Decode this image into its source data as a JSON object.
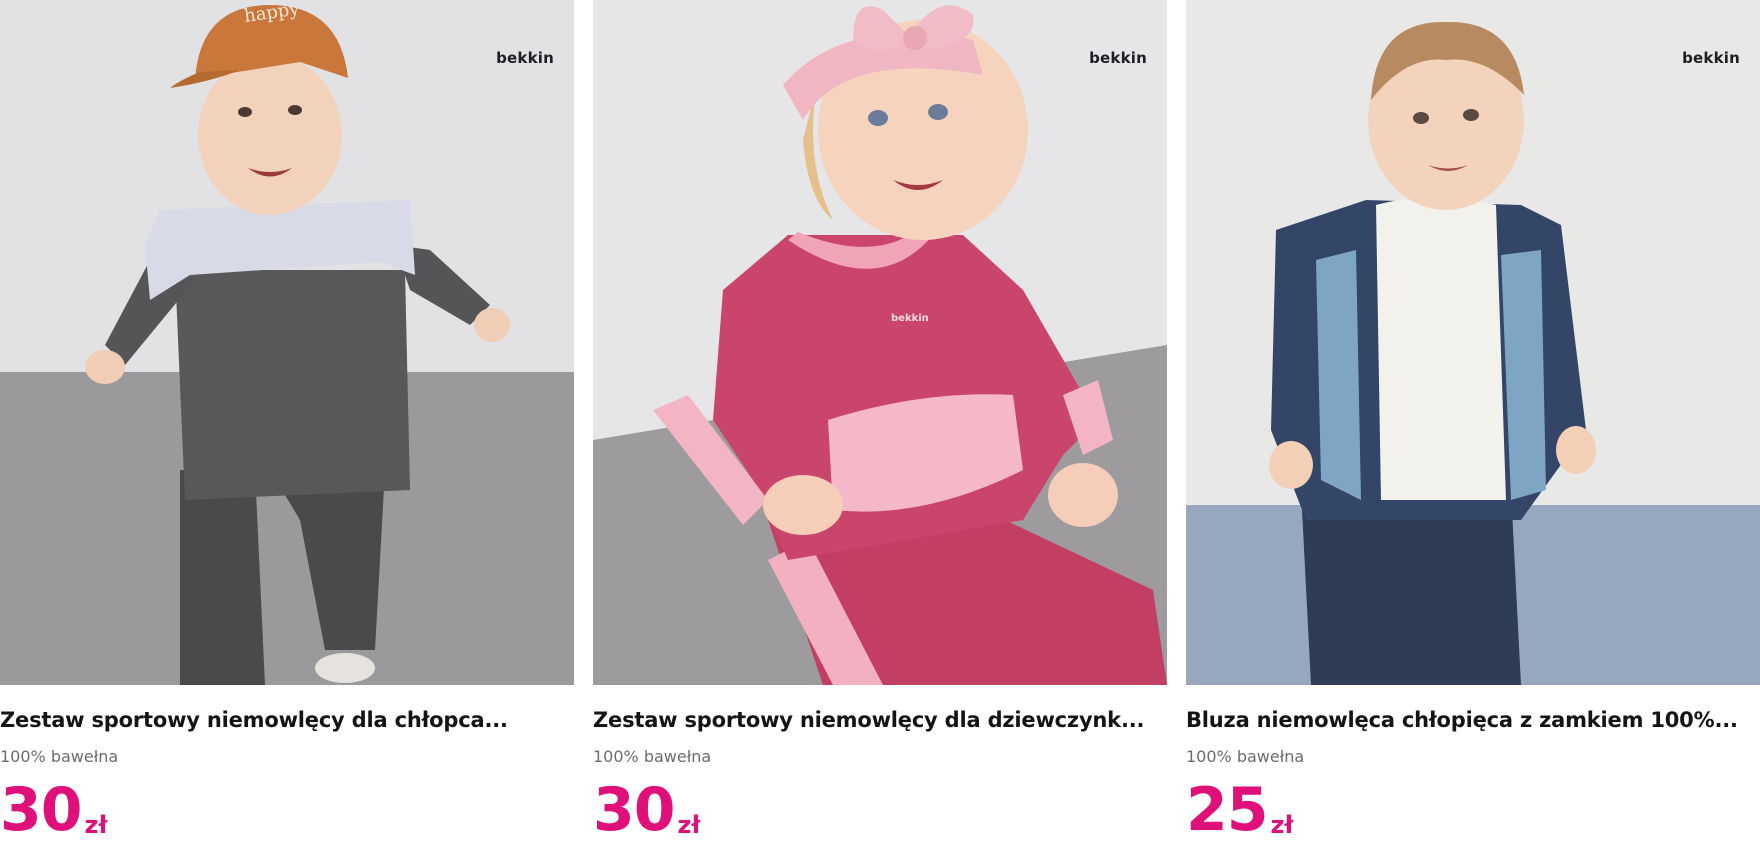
{
  "products": [
    {
      "brand": "bekkin",
      "title": "Zestaw sportowy niemowlęcy dla chłopca...",
      "material": "100% bawełna",
      "price": "30",
      "currency": "zł",
      "image_icon": "baby-boy-grey-tracksuit-photo"
    },
    {
      "brand": "bekkin",
      "title": "Zestaw sportowy niemowlęcy dla dziewczynk...",
      "material": "100% bawełna",
      "price": "30",
      "currency": "zł",
      "chest_logo": "bekkin",
      "image_icon": "baby-girl-pink-tracksuit-photo"
    },
    {
      "brand": "bekkin",
      "title": "Bluza niemowlęca chłopięca z zamkiem 100%...",
      "material": "100% bawełna",
      "price": "25",
      "currency": "zł",
      "image_icon": "baby-boy-zip-hoodie-photo"
    }
  ],
  "colors": {
    "price": "#e0107a",
    "title": "#141418",
    "subtitle": "#6b6b72"
  }
}
